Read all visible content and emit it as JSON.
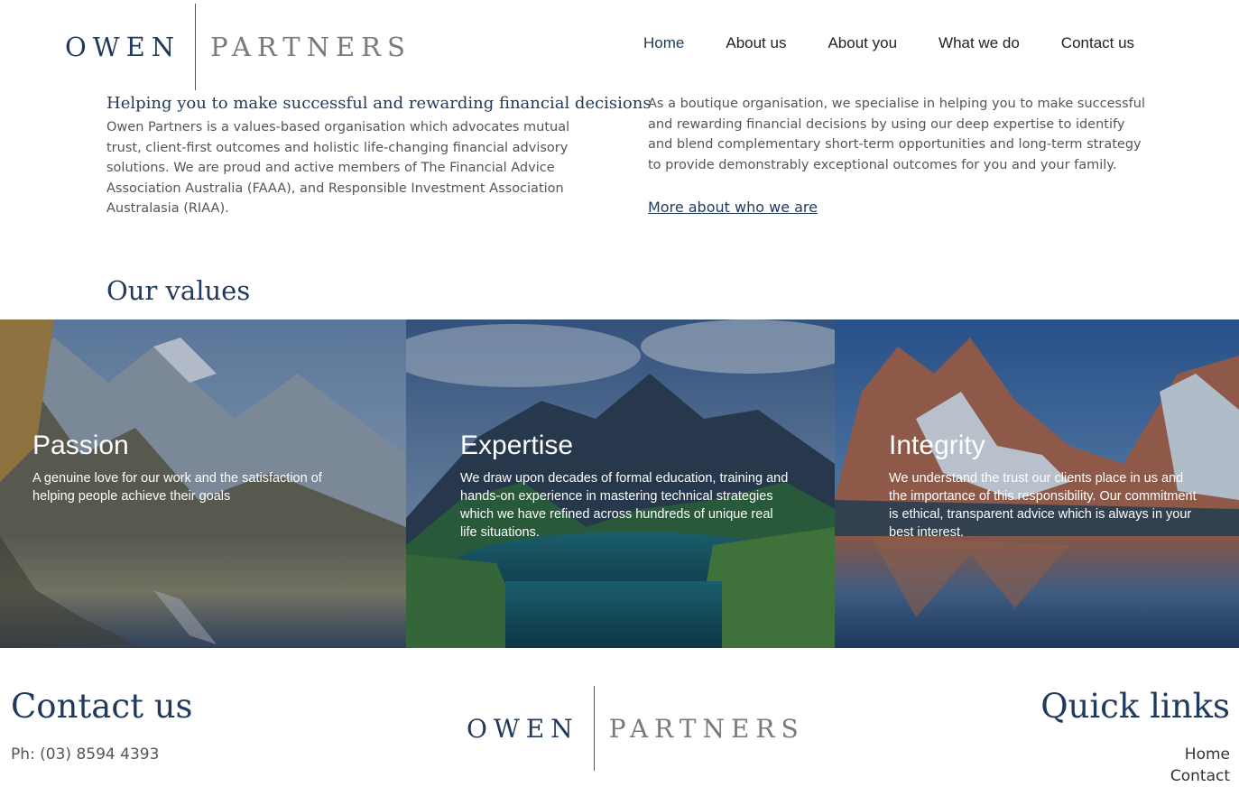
{
  "brand": {
    "name_part1": "OWEN",
    "name_part2": "PARTNERS",
    "primary_color": "#1f3a5c",
    "secondary_color": "#7a7a7a"
  },
  "nav": {
    "items": [
      {
        "label": "Home",
        "active": true
      },
      {
        "label": "About us"
      },
      {
        "label": "About you"
      },
      {
        "label": "What we do"
      },
      {
        "label": "Contact us"
      }
    ]
  },
  "intro": {
    "heading": "Helping you to make successful and rewarding financial decisions",
    "body": "Owen Partners is a values-based organisation which advocates mutual trust, client-first outcomes and holistic life-changing financial advisory solutions. We are proud and active members of The Financial Advice Association Australia (FAAA), and Responsible Investment Association Australasia (RIAA).",
    "right_body": "As a boutique organisation, we specialise in helping you to make successful and rewarding financial decisions by using our deep expertise to identify and blend complementary short-term opportunities and long-term strategy to provide demonstrably exceptional outcomes for you and your family.",
    "more_link": "More about who we are"
  },
  "values": {
    "title": "Our values",
    "items": [
      {
        "title": "Passion",
        "text": "A genuine love for our work and the satisfaction of helping people achieve their goals"
      },
      {
        "title": "Expertise",
        "text": "We draw upon decades of formal education, training and hands-on experience in mastering technical strategies which we have refined across hundreds of unique real life situations."
      },
      {
        "title": "Integrity",
        "text": "We understand the trust our clients place in us and the importance of this responsibility. Our commitment is ethical, transparent advice which is always in your best interest."
      }
    ]
  },
  "footer": {
    "contact_heading": "Contact us",
    "phone": "Ph: (03) 8594 4393",
    "quick_links_heading": "Quick links",
    "quick_links": [
      "Home",
      "Contact"
    ]
  }
}
